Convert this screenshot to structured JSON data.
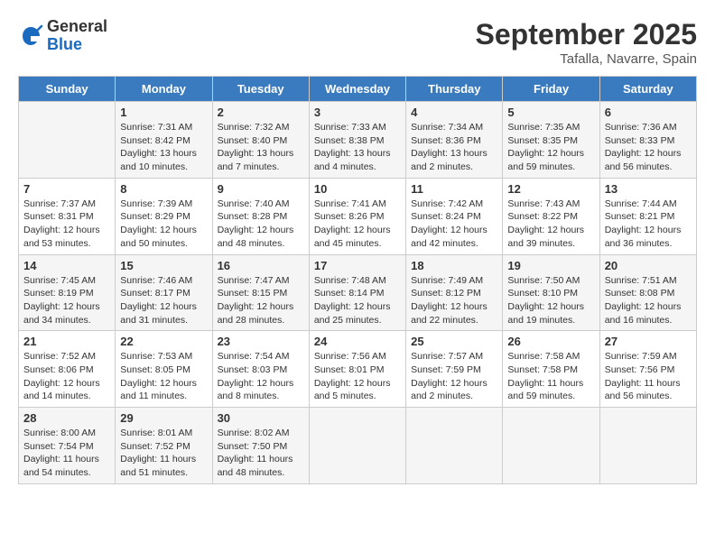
{
  "logo": {
    "general": "General",
    "blue": "Blue"
  },
  "title": "September 2025",
  "location": "Tafalla, Navarre, Spain",
  "weekdays": [
    "Sunday",
    "Monday",
    "Tuesday",
    "Wednesday",
    "Thursday",
    "Friday",
    "Saturday"
  ],
  "weeks": [
    [
      {
        "day": "",
        "info": ""
      },
      {
        "day": "1",
        "info": "Sunrise: 7:31 AM\nSunset: 8:42 PM\nDaylight: 13 hours\nand 10 minutes."
      },
      {
        "day": "2",
        "info": "Sunrise: 7:32 AM\nSunset: 8:40 PM\nDaylight: 13 hours\nand 7 minutes."
      },
      {
        "day": "3",
        "info": "Sunrise: 7:33 AM\nSunset: 8:38 PM\nDaylight: 13 hours\nand 4 minutes."
      },
      {
        "day": "4",
        "info": "Sunrise: 7:34 AM\nSunset: 8:36 PM\nDaylight: 13 hours\nand 2 minutes."
      },
      {
        "day": "5",
        "info": "Sunrise: 7:35 AM\nSunset: 8:35 PM\nDaylight: 12 hours\nand 59 minutes."
      },
      {
        "day": "6",
        "info": "Sunrise: 7:36 AM\nSunset: 8:33 PM\nDaylight: 12 hours\nand 56 minutes."
      }
    ],
    [
      {
        "day": "7",
        "info": "Sunrise: 7:37 AM\nSunset: 8:31 PM\nDaylight: 12 hours\nand 53 minutes."
      },
      {
        "day": "8",
        "info": "Sunrise: 7:39 AM\nSunset: 8:29 PM\nDaylight: 12 hours\nand 50 minutes."
      },
      {
        "day": "9",
        "info": "Sunrise: 7:40 AM\nSunset: 8:28 PM\nDaylight: 12 hours\nand 48 minutes."
      },
      {
        "day": "10",
        "info": "Sunrise: 7:41 AM\nSunset: 8:26 PM\nDaylight: 12 hours\nand 45 minutes."
      },
      {
        "day": "11",
        "info": "Sunrise: 7:42 AM\nSunset: 8:24 PM\nDaylight: 12 hours\nand 42 minutes."
      },
      {
        "day": "12",
        "info": "Sunrise: 7:43 AM\nSunset: 8:22 PM\nDaylight: 12 hours\nand 39 minutes."
      },
      {
        "day": "13",
        "info": "Sunrise: 7:44 AM\nSunset: 8:21 PM\nDaylight: 12 hours\nand 36 minutes."
      }
    ],
    [
      {
        "day": "14",
        "info": "Sunrise: 7:45 AM\nSunset: 8:19 PM\nDaylight: 12 hours\nand 34 minutes."
      },
      {
        "day": "15",
        "info": "Sunrise: 7:46 AM\nSunset: 8:17 PM\nDaylight: 12 hours\nand 31 minutes."
      },
      {
        "day": "16",
        "info": "Sunrise: 7:47 AM\nSunset: 8:15 PM\nDaylight: 12 hours\nand 28 minutes."
      },
      {
        "day": "17",
        "info": "Sunrise: 7:48 AM\nSunset: 8:14 PM\nDaylight: 12 hours\nand 25 minutes."
      },
      {
        "day": "18",
        "info": "Sunrise: 7:49 AM\nSunset: 8:12 PM\nDaylight: 12 hours\nand 22 minutes."
      },
      {
        "day": "19",
        "info": "Sunrise: 7:50 AM\nSunset: 8:10 PM\nDaylight: 12 hours\nand 19 minutes."
      },
      {
        "day": "20",
        "info": "Sunrise: 7:51 AM\nSunset: 8:08 PM\nDaylight: 12 hours\nand 16 minutes."
      }
    ],
    [
      {
        "day": "21",
        "info": "Sunrise: 7:52 AM\nSunset: 8:06 PM\nDaylight: 12 hours\nand 14 minutes."
      },
      {
        "day": "22",
        "info": "Sunrise: 7:53 AM\nSunset: 8:05 PM\nDaylight: 12 hours\nand 11 minutes."
      },
      {
        "day": "23",
        "info": "Sunrise: 7:54 AM\nSunset: 8:03 PM\nDaylight: 12 hours\nand 8 minutes."
      },
      {
        "day": "24",
        "info": "Sunrise: 7:56 AM\nSunset: 8:01 PM\nDaylight: 12 hours\nand 5 minutes."
      },
      {
        "day": "25",
        "info": "Sunrise: 7:57 AM\nSunset: 7:59 PM\nDaylight: 12 hours\nand 2 minutes."
      },
      {
        "day": "26",
        "info": "Sunrise: 7:58 AM\nSunset: 7:58 PM\nDaylight: 11 hours\nand 59 minutes."
      },
      {
        "day": "27",
        "info": "Sunrise: 7:59 AM\nSunset: 7:56 PM\nDaylight: 11 hours\nand 56 minutes."
      }
    ],
    [
      {
        "day": "28",
        "info": "Sunrise: 8:00 AM\nSunset: 7:54 PM\nDaylight: 11 hours\nand 54 minutes."
      },
      {
        "day": "29",
        "info": "Sunrise: 8:01 AM\nSunset: 7:52 PM\nDaylight: 11 hours\nand 51 minutes."
      },
      {
        "day": "30",
        "info": "Sunrise: 8:02 AM\nSunset: 7:50 PM\nDaylight: 11 hours\nand 48 minutes."
      },
      {
        "day": "",
        "info": ""
      },
      {
        "day": "",
        "info": ""
      },
      {
        "day": "",
        "info": ""
      },
      {
        "day": "",
        "info": ""
      }
    ]
  ]
}
